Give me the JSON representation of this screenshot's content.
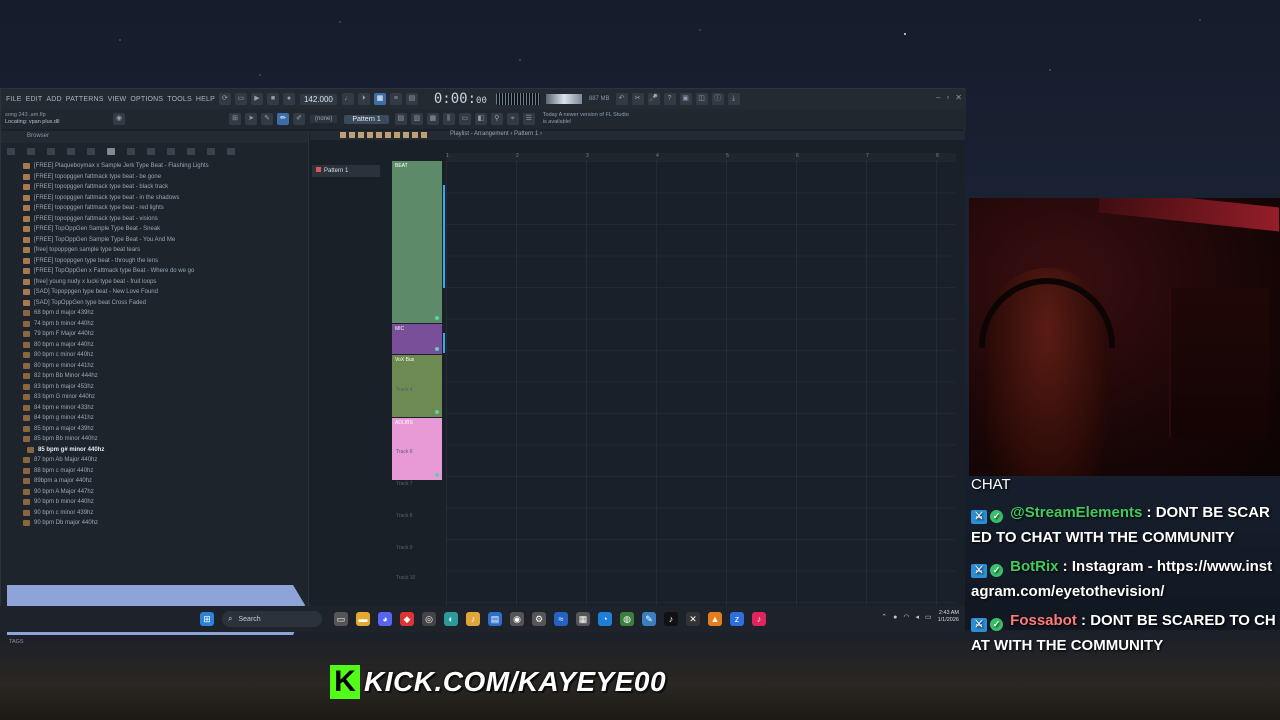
{
  "fl_studio": {
    "menu": [
      "FILE",
      "EDIT",
      "ADD",
      "PATTERNS",
      "VIEW",
      "OPTIONS",
      "TOOLS",
      "HELP"
    ],
    "tempo": "142.000",
    "time": "0:00",
    "time_small": "00",
    "cpu": "887 MB",
    "song_file": "song 243 .am.flp",
    "song_hint": "Locating: vpan plus.dll",
    "pattern_selector": "Pattern 1",
    "mode": "(none)",
    "news": "Today  A newer version of FL Studio is available!",
    "window_controls": [
      "–",
      "▫",
      "✕"
    ]
  },
  "browser": {
    "title": "Browser",
    "items": [
      {
        "label": "[FREE] Plaqueboymax x Sample Jerk Type Beat - Flashing Lights",
        "folder": false
      },
      {
        "label": "[FREE] topopggen  fattmack type beat - be gone",
        "folder": false
      },
      {
        "label": "[FREE] topopggen  fattmack type beat - black track",
        "folder": false
      },
      {
        "label": "[FREE] topopggen  fattmack type beat - in the shadows",
        "folder": false
      },
      {
        "label": "[FREE] topopggen  fattmack type beat - red lights",
        "folder": false
      },
      {
        "label": "[FREE] topopggen  fattmack type beat - visions",
        "folder": false
      },
      {
        "label": "[FREE] TopOppGen Sample Type Beat - Sneak",
        "folder": false
      },
      {
        "label": "[FREE] TopOppGen Sample Type Beat - You And Me",
        "folder": false
      },
      {
        "label": "[free] topoppgen sample type beat tears",
        "folder": false
      },
      {
        "label": "[FREE] topoppgen type beat - through the lens",
        "folder": false
      },
      {
        "label": "[FREE] TopOppGen x Fattmack type Beat - Where do we go",
        "folder": false
      },
      {
        "label": "[free] young nudy x lucki type beat - fruit loops",
        "folder": false
      },
      {
        "label": "[SAD] Topoppgen type beat - New Love Found",
        "folder": false
      },
      {
        "label": "[SAD] TopOppGen type beat Cross Faded",
        "folder": false
      },
      {
        "label": "68 bpm d major 439hz",
        "folder": true
      },
      {
        "label": "74 bpm b minor 440hz",
        "folder": true
      },
      {
        "label": "79 bpm F Major 440hz",
        "folder": true
      },
      {
        "label": "80 bpm a major 440hz",
        "folder": true
      },
      {
        "label": "80 bpm c minor 440hz",
        "folder": true
      },
      {
        "label": "80 bpm e minor 441hz",
        "folder": true
      },
      {
        "label": "82 bpm Bb Minor 444hz",
        "folder": true
      },
      {
        "label": "83 bpm b major 453hz",
        "folder": true
      },
      {
        "label": "83 bpm G minor 440hz",
        "folder": true
      },
      {
        "label": "84 bpm e minor 433hz",
        "folder": true
      },
      {
        "label": "84 bpm g minor 441hz",
        "folder": true
      },
      {
        "label": "85 bpm a major 439hz",
        "folder": true
      },
      {
        "label": "85 bpm Bb minor 440hz",
        "folder": true
      },
      {
        "label": "85 bpm g# minor 440hz",
        "folder": true,
        "selected": true
      },
      {
        "label": "87 bpm Ab Major 440hz",
        "folder": true
      },
      {
        "label": "88 bpm c major 440hz",
        "folder": true
      },
      {
        "label": "89bpm a major 440hz",
        "folder": true
      },
      {
        "label": "90 bpm A Major 447hz",
        "folder": true
      },
      {
        "label": "90 bpm b minor 440hz",
        "folder": true
      },
      {
        "label": "90 bpm c minor 439hz",
        "folder": true
      },
      {
        "label": "90 bpm Db major 440hz",
        "folder": true
      }
    ],
    "tags_label": "TAGS"
  },
  "playlist": {
    "title": "Playlist - Arrangement › Pattern 1 ›",
    "pattern_item": "Pattern 1",
    "ruler": [
      "1",
      "2",
      "3",
      "4",
      "5",
      "6",
      "7",
      "8"
    ],
    "tracks": [
      {
        "label": "BEAT",
        "color": "#5d8a69"
      },
      {
        "label": "MIC",
        "color": "#7a4f9a"
      },
      {
        "label": "VoX Bus",
        "color": "#6d8a52"
      },
      {
        "label": "ADLIBS",
        "color": "#e79ad6"
      }
    ],
    "ghost_tracks": [
      "Track 4",
      "Track 6",
      "Track 7",
      "Track 8",
      "Track 9",
      "Track 10"
    ]
  },
  "taskbar": {
    "search_placeholder": "Search",
    "time": "2:43 AM",
    "date": "1/1/2026"
  },
  "stream": {
    "kick_url": "KICK.COM/KAYEYE00",
    "chat_title": "CHAT",
    "messages": [
      {
        "user": "@StreamElements",
        "text": "DONT BE SCARED TO CHAT WITH THE COMMUNITY"
      },
      {
        "user": "BotRix",
        "text": "Instagram - https://www.instagram.com/eyetothevision/"
      },
      {
        "user": "Fossabot",
        "text": "DONT BE SCARED TO CHAT WITH THE COMMUNITY"
      }
    ]
  }
}
